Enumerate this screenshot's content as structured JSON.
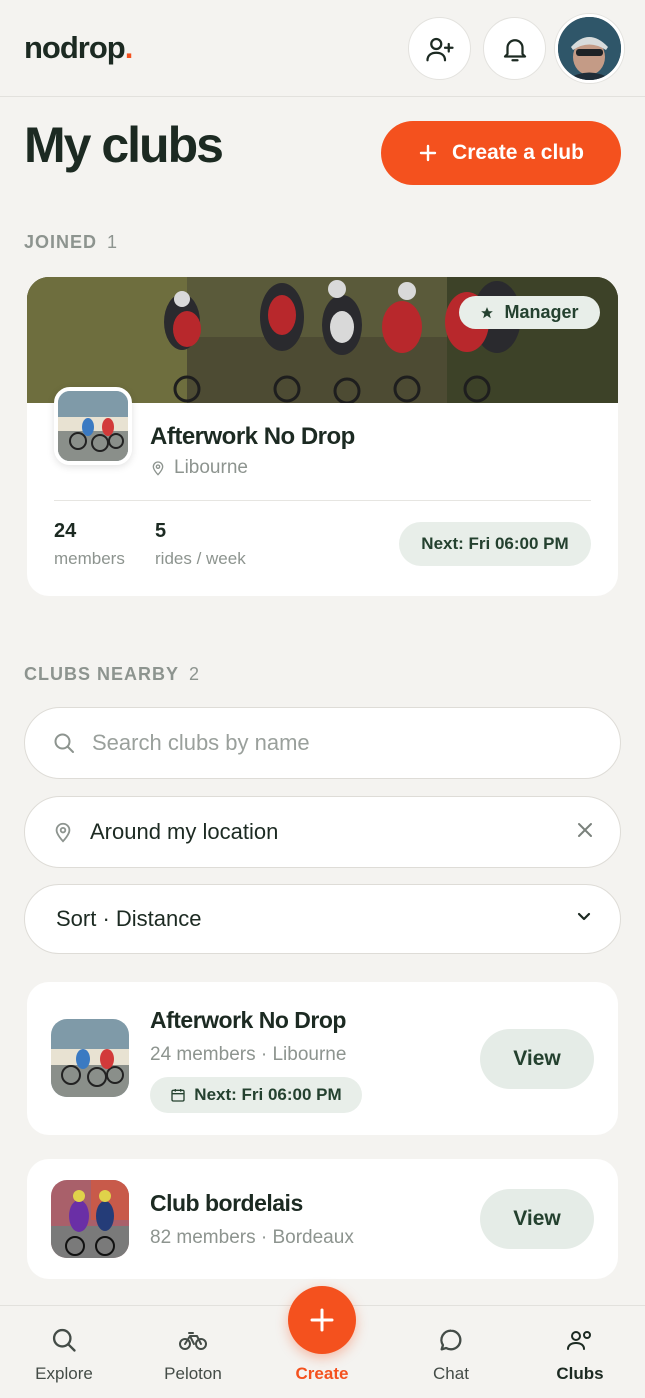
{
  "app": {
    "logo_text": "nodrop",
    "logo_dot": ".",
    "accent": "#f4511e"
  },
  "header": {
    "add_friend_icon": "user-plus-icon",
    "notifications_icon": "bell-icon",
    "avatar_icon": "profile-avatar"
  },
  "page": {
    "title": "My clubs",
    "create_button": "Create a club"
  },
  "joined": {
    "label": "JOINED",
    "count": "1",
    "club": {
      "name": "Afterwork No Drop",
      "location": "Libourne",
      "badge": "Manager",
      "members_value": "24",
      "members_label": "members",
      "rides_value": "5",
      "rides_label": "rides / week",
      "next": "Next: Fri 06:00 PM"
    }
  },
  "nearby": {
    "label": "CLUBS NEARBY",
    "count": "2",
    "search_placeholder": "Search clubs by name",
    "location_value": "Around my location",
    "sort_value": "Sort · Distance",
    "clubs": [
      {
        "name": "Afterwork No Drop",
        "meta": "24 members · Libourne",
        "next": "Next: Fri 06:00 PM",
        "button": "View"
      },
      {
        "name": "Club bordelais",
        "meta": "82 members · Bordeaux",
        "button": "View"
      }
    ]
  },
  "nav": {
    "explore": "Explore",
    "peloton": "Peloton",
    "create": "Create",
    "chat": "Chat",
    "clubs": "Clubs"
  }
}
